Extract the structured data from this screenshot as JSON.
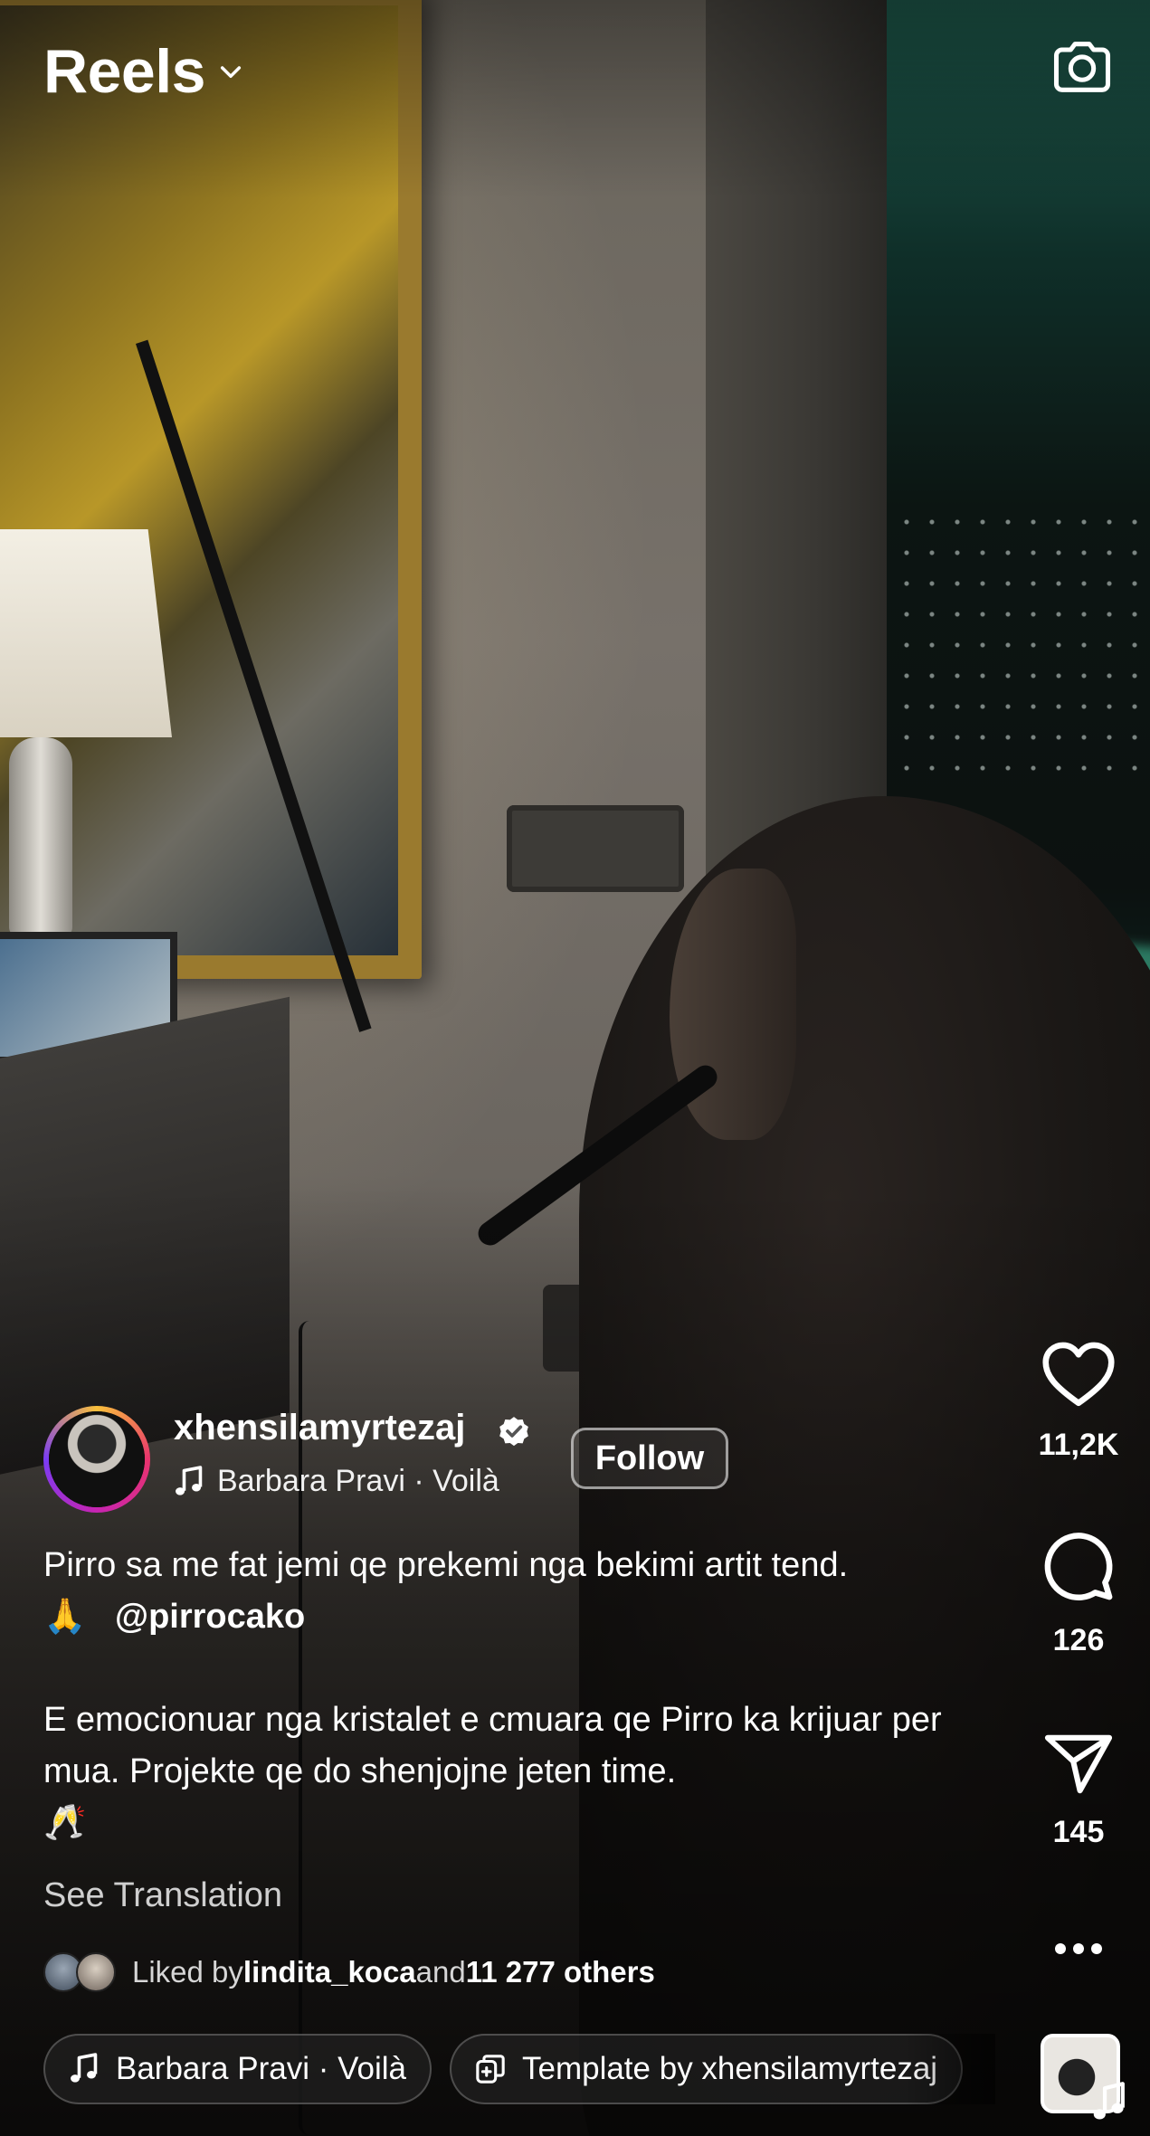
{
  "header": {
    "title": "Reels",
    "title_icon": "chevron-down-icon",
    "camera_icon": "camera-icon"
  },
  "actions": {
    "like": {
      "icon": "heart-icon",
      "count": "11,2K"
    },
    "comment": {
      "icon": "comment-icon",
      "count": "126"
    },
    "share": {
      "icon": "send-icon",
      "count": "145"
    },
    "more_icon": "more-icon"
  },
  "post": {
    "username": "xhensilamyrtezaj",
    "verified_icon": "verified-badge-icon",
    "audio_label": "Barbara Pravi · Voilà",
    "follow_label": "Follow",
    "caption": {
      "line1": "Pirro sa me fat jemi qe prekemi nga bekimi artit tend.",
      "emoji1": "🙏",
      "mention": "@pirrocako",
      "line2": "E emocionuar nga kristalet e cmuara qe Pirro ka krijuar per mua. Projekte qe do shenjojne jeten time.",
      "emoji2": "🥂"
    },
    "see_translation": "See Translation",
    "liked": {
      "prefix": "Liked by ",
      "user": "lindita_koca",
      "middle": " and ",
      "others": "11 277 others"
    }
  },
  "chips": {
    "audio": "Barbara Pravi · Voilà",
    "template": "Template by xhensilamyrtezaj"
  },
  "colors": {
    "text": "#ffffff",
    "muted": "#cfcfcf",
    "story_ring": [
      "#f9c03b",
      "#e8336d",
      "#c724b1"
    ]
  }
}
